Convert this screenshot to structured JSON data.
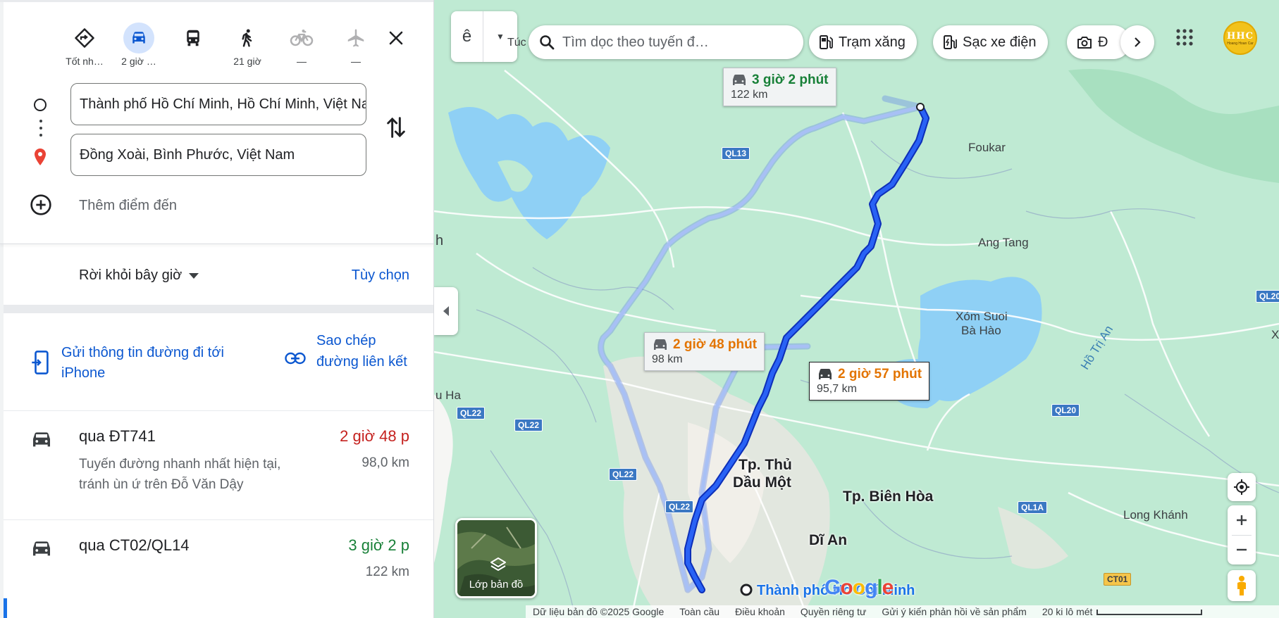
{
  "travel_modes": [
    {
      "id": "best",
      "label": "Tốt nh…",
      "icon": "directions-diamond-icon",
      "active": false
    },
    {
      "id": "car",
      "label": "2 giờ …",
      "icon": "car-icon",
      "active": true
    },
    {
      "id": "transit",
      "label": "",
      "icon": "bus-icon",
      "active": false
    },
    {
      "id": "walk",
      "label": "21 giờ",
      "icon": "walk-icon",
      "active": false
    },
    {
      "id": "bike",
      "label": "—",
      "icon": "bicycle-icon",
      "active": false
    },
    {
      "id": "flight",
      "label": "—",
      "icon": "airplane-icon",
      "active": false
    }
  ],
  "inputs": {
    "origin": "Thành phố Hồ Chí Minh, Hồ Chí Minh, Việt Nam",
    "destination": "Đồng Xoài, Bình Phước, Việt Nam",
    "add_destination": "Thêm điểm đến"
  },
  "depart": {
    "label": "Rời khỏi bây giờ",
    "options": "Tùy chọn"
  },
  "share": {
    "send_to_phone": "Gửi thông tin đường đi tới iPhone",
    "copy_link": "Sao chép đường liên kết"
  },
  "routes": [
    {
      "via": "qua ĐT741",
      "description": "Tuyến đường nhanh nhất hiện tại, tránh ùn ứ trên Đỗ Văn Dậy",
      "time": "2 giờ 48 p",
      "distance": "98,0 km",
      "time_color": "#c5221f"
    },
    {
      "via": "qua CT02/QL14",
      "description": "",
      "time": "3 giờ 2 p",
      "distance": "122 km",
      "time_color": "#188038"
    }
  ],
  "map": {
    "tab_letter": "ê",
    "corner_label": "Túc",
    "search_placeholder": "Tìm dọc theo tuyến đ…",
    "chips": [
      {
        "label": "Trạm xăng",
        "icon": "gas-station-icon"
      },
      {
        "label": "Sạc xe điện",
        "icon": "ev-charger-icon"
      },
      {
        "label": "Đ",
        "icon": "camera-icon"
      }
    ],
    "avatar_text": "HHC",
    "avatar_sub": "Hoang Hoan Car",
    "callouts": [
      {
        "time": "3 giờ 2 phút",
        "distance": "122 km",
        "color": "#188038"
      },
      {
        "time": "2 giờ 48 phút",
        "distance": "98 km",
        "color": "#e37400"
      },
      {
        "time": "2 giờ 57 phút",
        "distance": "95,7 km",
        "color": "#e37400"
      }
    ],
    "places": {
      "foukar": "Foukar",
      "ang_tang": "Ang Tang",
      "xom_suoi": "Xóm Suoi",
      "ba_hao": "Bà Hào",
      "ho_tri_an": "Hồ Trị An",
      "thu_dau_mot_1": "Tp. Thủ",
      "thu_dau_mot_2": "Dầu Một",
      "bien_hoa": "Tp. Biên Hòa",
      "di_an": "Dĩ An",
      "long_khanh": "Long Khánh",
      "left_h": "h",
      "u_ha": "u Ha",
      "right_x": "X",
      "origin_label": "Thành phố Hồ Chí Minh"
    },
    "road_labels": [
      "QL13",
      "QL22",
      "QL22",
      "QL22",
      "QL22",
      "QL20",
      "QL20",
      "QL1A",
      "CT01"
    ],
    "layers_label": "Lớp bản đồ",
    "google": [
      "G",
      "o",
      "o",
      "g",
      "l",
      "e"
    ],
    "footer": [
      "Dữ liệu bản đồ ©2025 Google",
      "Toàn cầu",
      "Điều khoản",
      "Quyền riêng tư",
      "Gửi ý kiến phản hồi về sản phẩm",
      "20 ki lô mét"
    ]
  },
  "colors": {
    "primary_route": "#1a4fe0",
    "alt_route": "#a8c0f5",
    "link_blue": "#0b57d0",
    "water": "#8fd0f5",
    "land": "#bfead3"
  }
}
